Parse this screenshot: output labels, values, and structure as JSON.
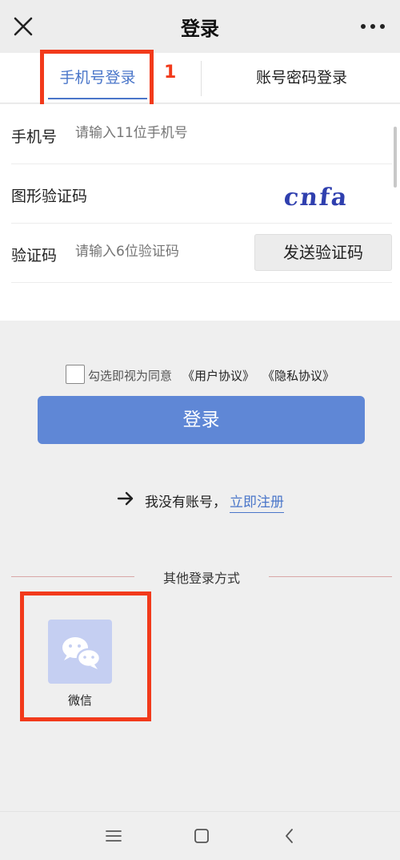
{
  "header": {
    "title": "登录",
    "close_icon": "close-icon",
    "more_icon": "more-icon"
  },
  "tabs": [
    {
      "label": "手机号登录",
      "active": true
    },
    {
      "label": "账号密码登录",
      "active": false
    }
  ],
  "annotation": {
    "step": "1",
    "color": "#f23a1b"
  },
  "form": {
    "phone": {
      "label": "手机号",
      "placeholder": "请输入11位手机号"
    },
    "captcha": {
      "label": "图形验证码",
      "image_text": "cnfa"
    },
    "code": {
      "label": "验证码",
      "placeholder": "请输入6位验证码",
      "send_button": "发送验证码"
    }
  },
  "agreement": {
    "text": "勾选即视为同意",
    "user_agreement": "《用户协议》",
    "privacy_agreement": "《隐私协议》",
    "checked": false
  },
  "login_button": {
    "label": "登录",
    "color": "#5f87d6"
  },
  "register": {
    "text": "我没有账号，",
    "link": "立即注册"
  },
  "other_login": {
    "title": "其他登录方式",
    "methods": [
      {
        "label": "微信",
        "icon": "wechat-icon"
      }
    ]
  },
  "system_nav": {
    "icons": [
      "menu-icon",
      "home-icon",
      "back-icon"
    ]
  },
  "colors": {
    "accent": "#4a76c9",
    "annotation": "#f23a1b",
    "wechat_tile": "#c5cff2"
  }
}
